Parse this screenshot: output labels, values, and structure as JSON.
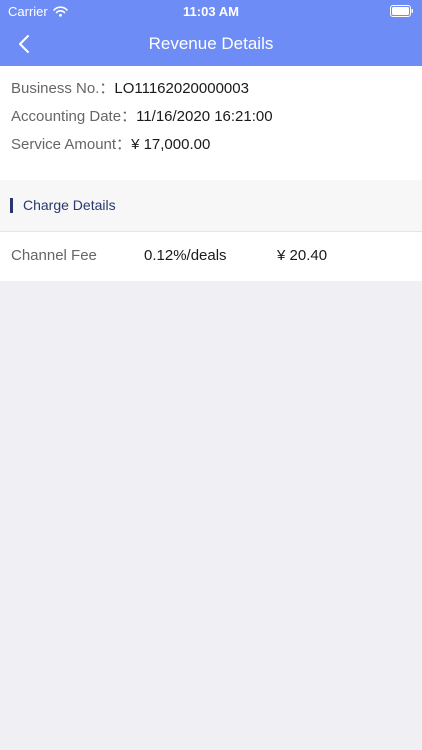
{
  "status_bar": {
    "carrier": "Carrier",
    "time": "11:03 AM",
    "icons": [
      "wifi-icon",
      "battery-icon"
    ]
  },
  "nav": {
    "title": "Revenue Details",
    "back_icon": "chevron-left-icon"
  },
  "summary": {
    "business_no_label": "Business No.：",
    "business_no_value": "LO11162020000003",
    "accounting_date_label": "Accounting Date：",
    "accounting_date_value": "11/16/2020 16:21:00",
    "service_amount_label": "Service Amount：",
    "service_amount_value": "¥ 17,000.00"
  },
  "charge_section": {
    "title": "Charge Details",
    "items": [
      {
        "name": "Channel Fee",
        "rate": "0.12%/deals",
        "amount": "¥ 20.40"
      }
    ]
  },
  "colors": {
    "header": "#6e8cf5",
    "background": "#efeff4",
    "section_accent": "#28386e"
  }
}
